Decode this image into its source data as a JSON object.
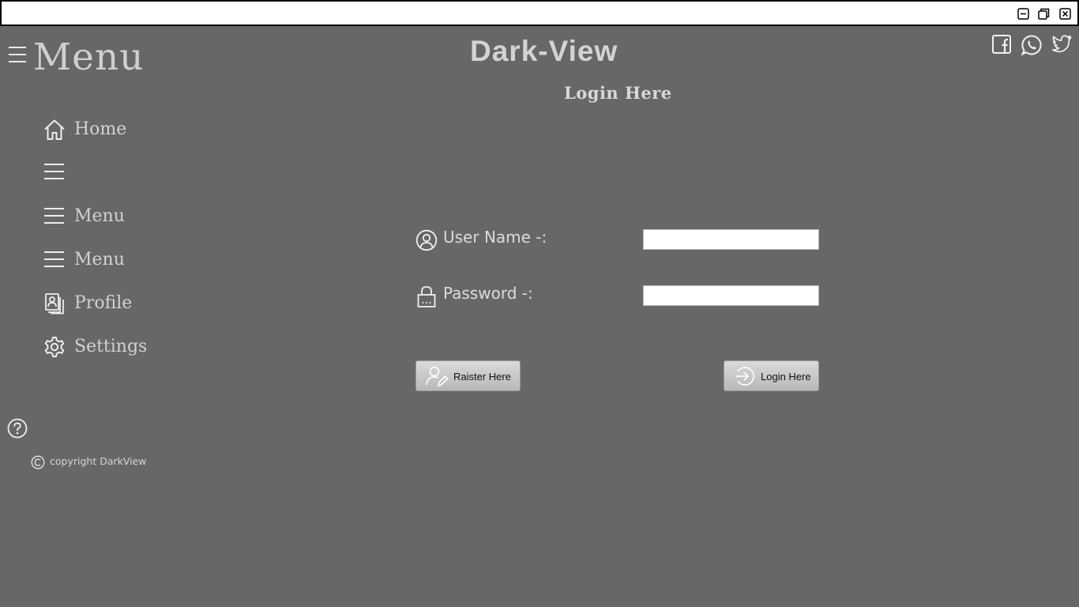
{
  "window": {
    "controls": [
      {
        "name": "minimize-icon"
      },
      {
        "name": "restore-icon"
      },
      {
        "name": "close-icon"
      }
    ]
  },
  "sidebar": {
    "title": "Menu",
    "toggle_icon": "hamburger-icon",
    "items": [
      {
        "label": "Home",
        "icon": "home-icon"
      },
      {
        "label": "",
        "icon": "hamburger-icon"
      },
      {
        "label": "Menu",
        "icon": "hamburger-icon"
      },
      {
        "label": "Menu",
        "icon": "hamburger-icon"
      },
      {
        "label": "Profile",
        "icon": "profile-icon"
      },
      {
        "label": "Settings",
        "icon": "gear-icon"
      }
    ],
    "help_icon": "help-icon",
    "copyright": "copyright DarkView"
  },
  "header": {
    "app_title": "Dark-View",
    "social": [
      "facebook-icon",
      "whatsapp-icon",
      "twitter-icon"
    ]
  },
  "login": {
    "title": "Login Here",
    "username_label": "User Name -:",
    "username_value": "",
    "password_label": "Password -:",
    "password_value": "",
    "register_button": "Raister  Here",
    "login_button": "Login Here"
  },
  "colors": {
    "background": "#676767",
    "text": "#d2d2d2",
    "titlebar": "#ffffff"
  }
}
